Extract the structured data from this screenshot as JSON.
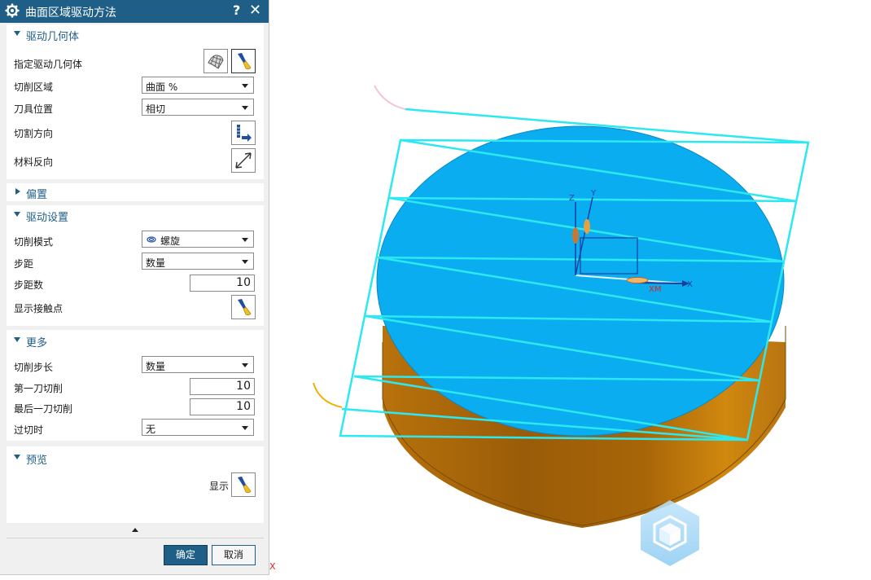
{
  "dialog": {
    "title": "曲面区域驱动方法",
    "help_label": "?",
    "close_label": "✕"
  },
  "groups": {
    "drive_geometry": {
      "title": "驱动几何体",
      "specify_label": "指定驱动几何体",
      "cut_area_label": "切削区域",
      "cut_area_value": "曲面 %",
      "tool_position_label": "刀具位置",
      "tool_position_value": "相切",
      "cut_direction_label": "切割方向",
      "material_reverse_label": "材料反向"
    },
    "offset": {
      "title": "偏置"
    },
    "drive_settings": {
      "title": "驱动设置",
      "cut_mode_label": "切削模式",
      "cut_mode_value": "螺旋",
      "stepover_label": "步距",
      "stepover_value": "数量",
      "step_count_label": "步距数",
      "step_count_value": "10",
      "show_contact_label": "显示接触点"
    },
    "more": {
      "title": "更多",
      "cut_step_label": "切削步长",
      "cut_step_value": "数量",
      "first_cut_label": "第一刀切削",
      "first_cut_value": "10",
      "last_cut_label": "最后一刀切削",
      "last_cut_value": "10",
      "overcut_label": "过切时",
      "overcut_value": "无"
    },
    "preview": {
      "title": "预览",
      "show_label": "显示"
    }
  },
  "buttons": {
    "ok": "确定",
    "cancel": "取消"
  },
  "viewport": {
    "axis_labels": {
      "z": "Z",
      "y": "Y",
      "x": "X",
      "xm": "XM"
    },
    "corner_mark": "X",
    "colors": {
      "top_face": "#0aaef0",
      "cylinder_side": "#c07a10",
      "toolpath": "#2ce8f0"
    }
  },
  "colors": {
    "accent": "#1f5e86",
    "panel_bg": "#f0f0f0"
  }
}
